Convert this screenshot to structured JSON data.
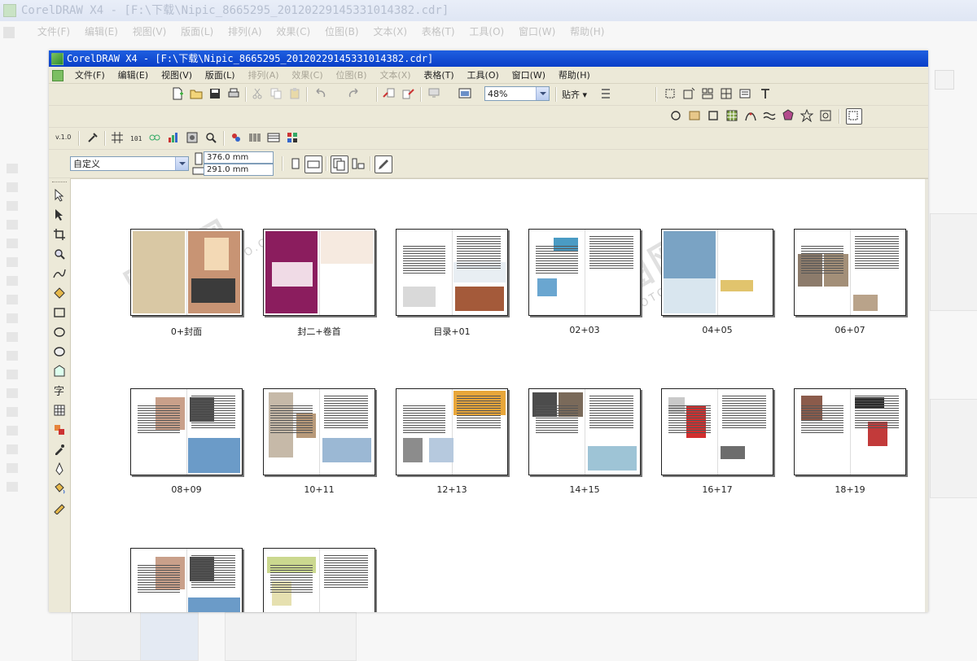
{
  "background": {
    "title": "CorelDRAW X4 - [F:\\下载\\Nipic_8665295_20120229145331014382.cdr]",
    "menus": [
      "文件(F)",
      "编辑(E)",
      "视图(V)",
      "版面(L)",
      "排列(A)",
      "效果(C)",
      "位图(B)",
      "文本(X)",
      "表格(T)",
      "工具(O)",
      "窗口(W)",
      "帮助(H)"
    ]
  },
  "window": {
    "title": "CorelDRAW X4 - [F:\\下载\\Nipic_8665295_20120229145331014382.cdr]",
    "menus": [
      {
        "label": "文件(F)",
        "enabled": true
      },
      {
        "label": "编辑(E)",
        "enabled": true
      },
      {
        "label": "视图(V)",
        "enabled": true
      },
      {
        "label": "版面(L)",
        "enabled": true
      },
      {
        "label": "排列(A)",
        "enabled": false
      },
      {
        "label": "效果(C)",
        "enabled": false
      },
      {
        "label": "位图(B)",
        "enabled": false
      },
      {
        "label": "文本(X)",
        "enabled": false
      },
      {
        "label": "表格(T)",
        "enabled": true
      },
      {
        "label": "工具(O)",
        "enabled": true
      },
      {
        "label": "窗口(W)",
        "enabled": true
      },
      {
        "label": "帮助(H)",
        "enabled": true
      }
    ]
  },
  "toolbar": {
    "zoom_value": "48%",
    "snap_label": "贴齐",
    "version_label": "v.1.0"
  },
  "property_bar": {
    "page_preset": "自定义",
    "width_value": "376.0 mm",
    "height_value": "291.0 mm"
  },
  "pages": [
    {
      "label": "0+封面",
      "style": "cover"
    },
    {
      "label": "封二+卷首",
      "style": "magenta"
    },
    {
      "label": "目录+01",
      "style": "toc"
    },
    {
      "label": "02+03",
      "style": "text-photo"
    },
    {
      "label": "04+05",
      "style": "city"
    },
    {
      "label": "06+07",
      "style": "people"
    },
    {
      "label": "08+09",
      "style": "blue"
    },
    {
      "label": "10+11",
      "style": "fashion"
    },
    {
      "label": "12+13",
      "style": "orange"
    },
    {
      "label": "14+15",
      "style": "dark-photo"
    },
    {
      "label": "16+17",
      "style": "red-figure"
    },
    {
      "label": "18+19",
      "style": "products"
    },
    {
      "label": "",
      "style": "blue"
    },
    {
      "label": "",
      "style": "jokes"
    }
  ],
  "watermark": {
    "cn": "昵图网",
    "en": "PHOTOPHOTO.CN"
  },
  "colors": {
    "titlebar": "#0a3fc8",
    "chrome": "#ece9d8",
    "canvas": "#ffffff"
  }
}
